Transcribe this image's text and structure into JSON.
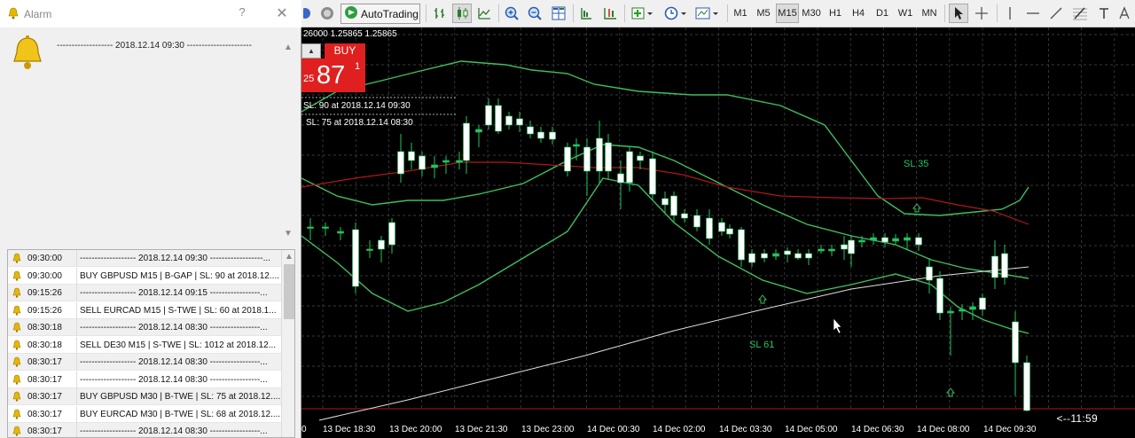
{
  "alarm": {
    "title": "Alarm",
    "help": "?",
    "close": "✕",
    "message": "------------------- 2018.12.14 09:30 ----------------------",
    "scroll_up": "▲",
    "scroll_down": "▼",
    "rows": [
      {
        "time": "09:30:00",
        "msg": "------------------- 2018.12.14 09:30 ------------------..."
      },
      {
        "time": "09:30:00",
        "msg": "BUY GBPUSD M15 | B-GAP | SL: 90 at 2018.12...."
      },
      {
        "time": "09:15:26",
        "msg": "------------------- 2018.12.14 09:15 -----------------..."
      },
      {
        "time": "09:15:26",
        "msg": "SELL EURCAD M15 | S-TWE | SL: 60 at 2018.1..."
      },
      {
        "time": "08:30:18",
        "msg": "------------------- 2018.12.14 08:30 -----------------..."
      },
      {
        "time": "08:30:18",
        "msg": "SELL DE30 M15 | S-TWE | SL: 1012 at 2018.12..."
      },
      {
        "time": "08:30:17",
        "msg": "------------------- 2018.12.14 08:30 -----------------..."
      },
      {
        "time": "08:30:17",
        "msg": "------------------- 2018.12.14 08:30 -----------------..."
      },
      {
        "time": "08:30:17",
        "msg": "BUY GBPUSD M30 | B-TWE | SL: 75 at 2018.12...."
      },
      {
        "time": "08:30:17",
        "msg": "BUY EURCAD M30 | B-TWE | SL: 68 at 2018.12...."
      },
      {
        "time": "08:30:17",
        "msg": "------------------- 2018.12.14 08:30 -----------------..."
      }
    ]
  },
  "toolbar": {
    "autotrading_label": "AutoTrading",
    "timeframes": [
      "M1",
      "M5",
      "M15",
      "M30",
      "H1",
      "H4",
      "D1",
      "W1",
      "MN"
    ],
    "active_timeframe": "M15",
    "icons": [
      "globe-icon",
      "autotrading-icon",
      "bar-chart-icon",
      "candlestick-icon",
      "line-chart-icon",
      "zoom-in-icon",
      "zoom-out-icon",
      "tile-windows-icon",
      "chart-shift-icon",
      "autoscroll-icon",
      "indicators-icon",
      "periods-icon",
      "templates-icon",
      "cursor-icon",
      "crosshair-icon",
      "vertical-line-icon",
      "horizontal-line-icon",
      "trendline-icon",
      "fibonacci-icon",
      "text-tool-icon",
      "text-label-icon"
    ]
  },
  "chart": {
    "ohlc_text": "26000 1.25865 1.25865",
    "trade": {
      "buy_label": "BUY",
      "arrow": "▲",
      "price_small": "25",
      "price_big": "87",
      "price_sup": "1"
    },
    "sl_labels": [
      "SL: 90 at 2018.12.14 09:30",
      "SL: 75 at 2018.12.14 08:30"
    ],
    "annotations": [
      "SL 35",
      "SL 61"
    ],
    "countdown": "<--11:59",
    "x_ticks": [
      "0",
      "13 Dec 18:30",
      "13 Dec 20:00",
      "13 Dec 21:30",
      "13 Dec 23:00",
      "14 Dec 00:30",
      "14 Dec 02:00",
      "14 Dec 03:30",
      "14 Dec 05:00",
      "14 Dec 06:30",
      "14 Dec 08:00",
      "14 Dec 09:30"
    ],
    "colors": {
      "background": "#000000",
      "grid": "#4a4a4a",
      "candle_up": "#22c55e",
      "candle_down": "#ffffff",
      "bollinger": "#3fbf5f",
      "ma_red": "#b01818",
      "trend_white": "#e0e0e0",
      "buy": "#e02020"
    }
  }
}
